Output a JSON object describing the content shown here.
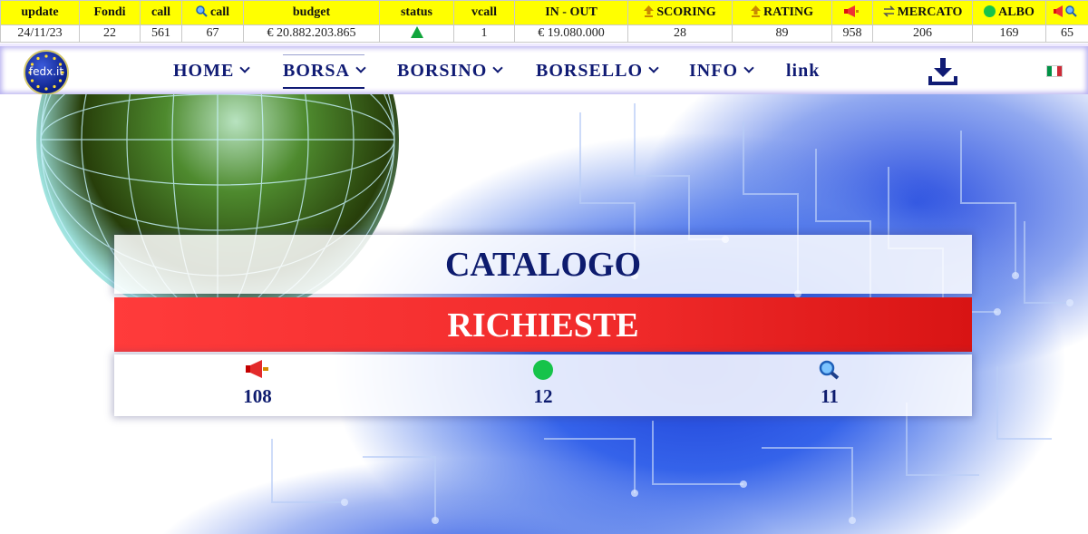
{
  "stats_table": {
    "headers": [
      "update",
      "Fondi",
      "call",
      "call",
      "budget",
      "status",
      "vcall",
      "IN - OUT",
      "SCORING",
      "RATING",
      "",
      "MERCATO",
      "ALBO",
      ""
    ],
    "header_icons": [
      "",
      "",
      "",
      "magnifier-icon",
      "",
      "",
      "",
      "",
      "upload-icon",
      "upload-icon",
      "megaphone-icon",
      "swap-icon",
      "green-dot-icon",
      "megaphone-search-icon"
    ],
    "values": [
      "24/11/23",
      "22",
      "561",
      "67",
      "€ 20.882.203.865",
      "",
      "1",
      "€ 19.080.000",
      "28",
      "89",
      "958",
      "206",
      "169",
      "65"
    ],
    "status_icon": "green-up-triangle"
  },
  "nav": {
    "logo_text": "fedx.it",
    "items": [
      {
        "label": "HOME"
      },
      {
        "label": "BORSA"
      },
      {
        "label": "BORSINO"
      },
      {
        "label": "BORSELLO"
      },
      {
        "label": "INFO"
      },
      {
        "label": "link"
      }
    ],
    "download_icon": "download-icon",
    "language_flag": "italy-flag-icon"
  },
  "hero": {
    "catalogo_label": "CATALOGO",
    "richieste_label": "RICHIESTE",
    "counters": [
      {
        "icon": "megaphone-icon",
        "value": "108"
      },
      {
        "icon": "green-dot-icon",
        "value": "12"
      },
      {
        "icon": "magnifier-icon",
        "value": "11"
      }
    ]
  },
  "colors": {
    "header_yellow": "#ffff00",
    "nav_text": "#101b74",
    "request_red": "#f02a2a",
    "status_green": "#11a53c"
  }
}
